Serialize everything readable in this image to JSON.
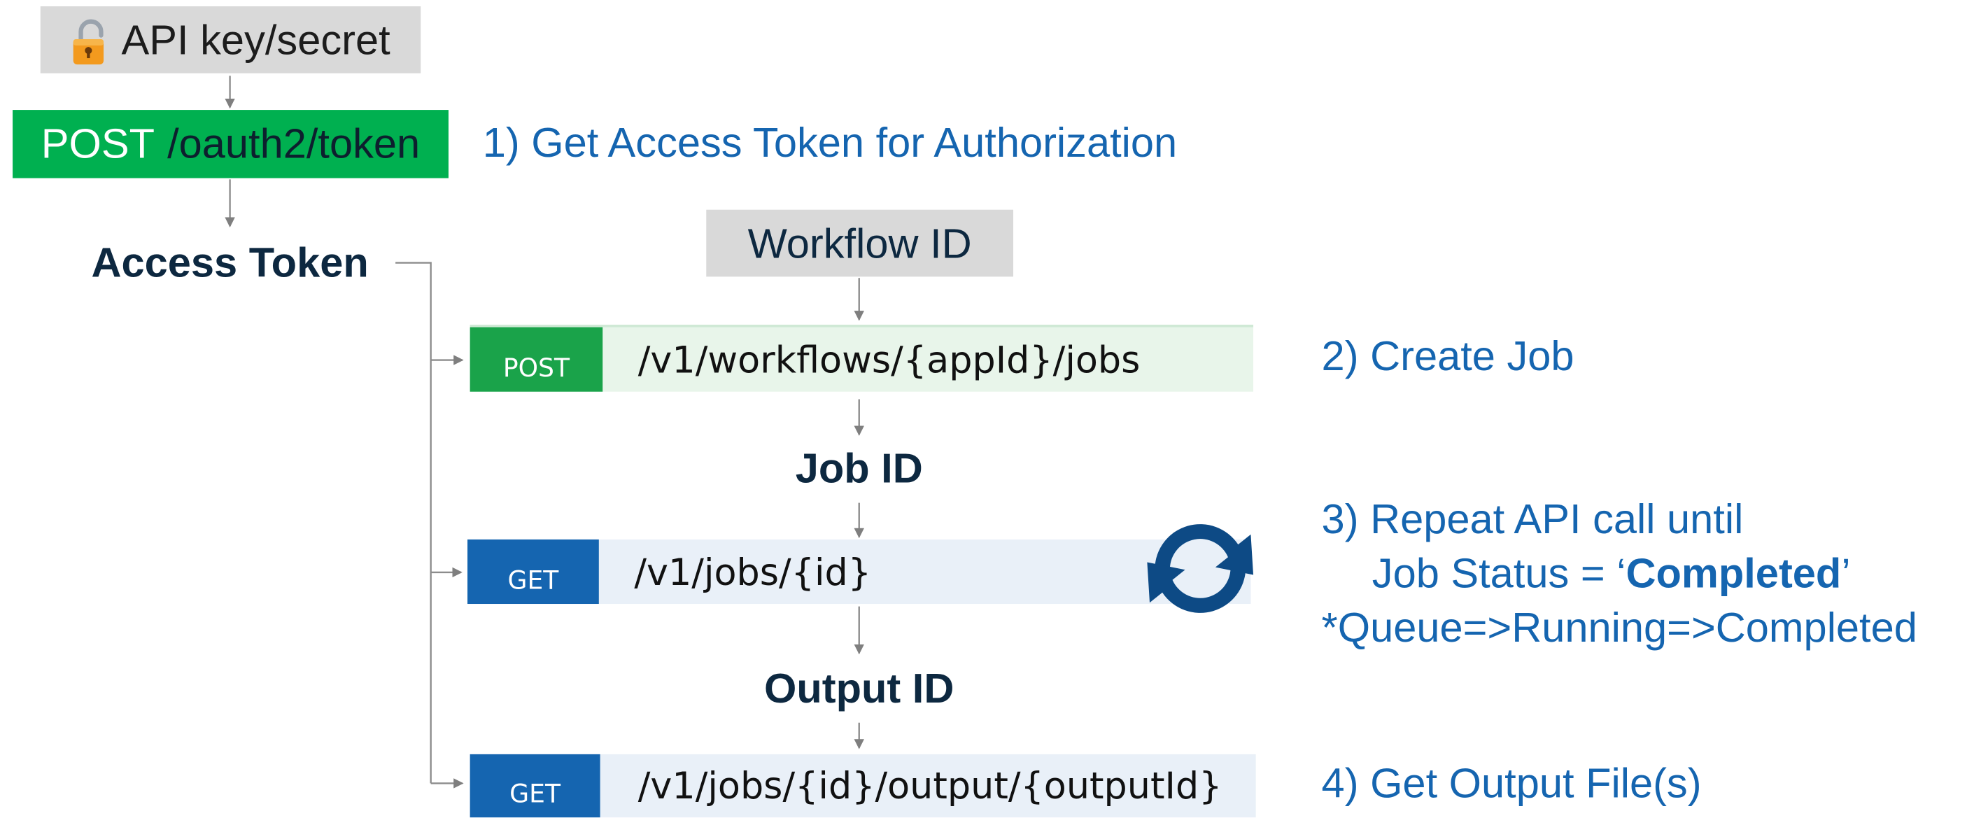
{
  "api_key": {
    "label": "API key/secret",
    "icon": "padlock-open-icon"
  },
  "oauth": {
    "method": "POST",
    "path": "/oauth2/token"
  },
  "access_token": "Access Token",
  "workflow_id": "Workflow ID",
  "job_id": "Job ID",
  "output_id": "Output ID",
  "steps": {
    "step1": "1) Get Access Token for Authorization",
    "step2": "2) Create Job",
    "step3_line1": "3) Repeat API call until",
    "step3_prefix": "Job Status = ‘",
    "step3_bold": "Completed",
    "step3_suffix": "’",
    "step3_line3": "*Queue=>Running=>Completed",
    "step4": "4) Get Output File(s)"
  },
  "endpoints": [
    {
      "method": "POST",
      "path": "/v1/workflows/{appId}/jobs"
    },
    {
      "method": "GET",
      "path": "/v1/jobs/{id}"
    },
    {
      "method": "GET",
      "path": "/v1/jobs/{id}/output/{outputId}"
    }
  ],
  "refresh_icon": "refresh-cycle-icon",
  "colors": {
    "green": "#00b050",
    "post_badge": "#1aa34a",
    "post_bg": "#e8f5ea",
    "get_badge": "#1565b0",
    "get_bg": "#e9f0f8",
    "step_blue": "#1565b0",
    "label_dark": "#0d2840",
    "refresh_blue": "#0d4a85"
  }
}
